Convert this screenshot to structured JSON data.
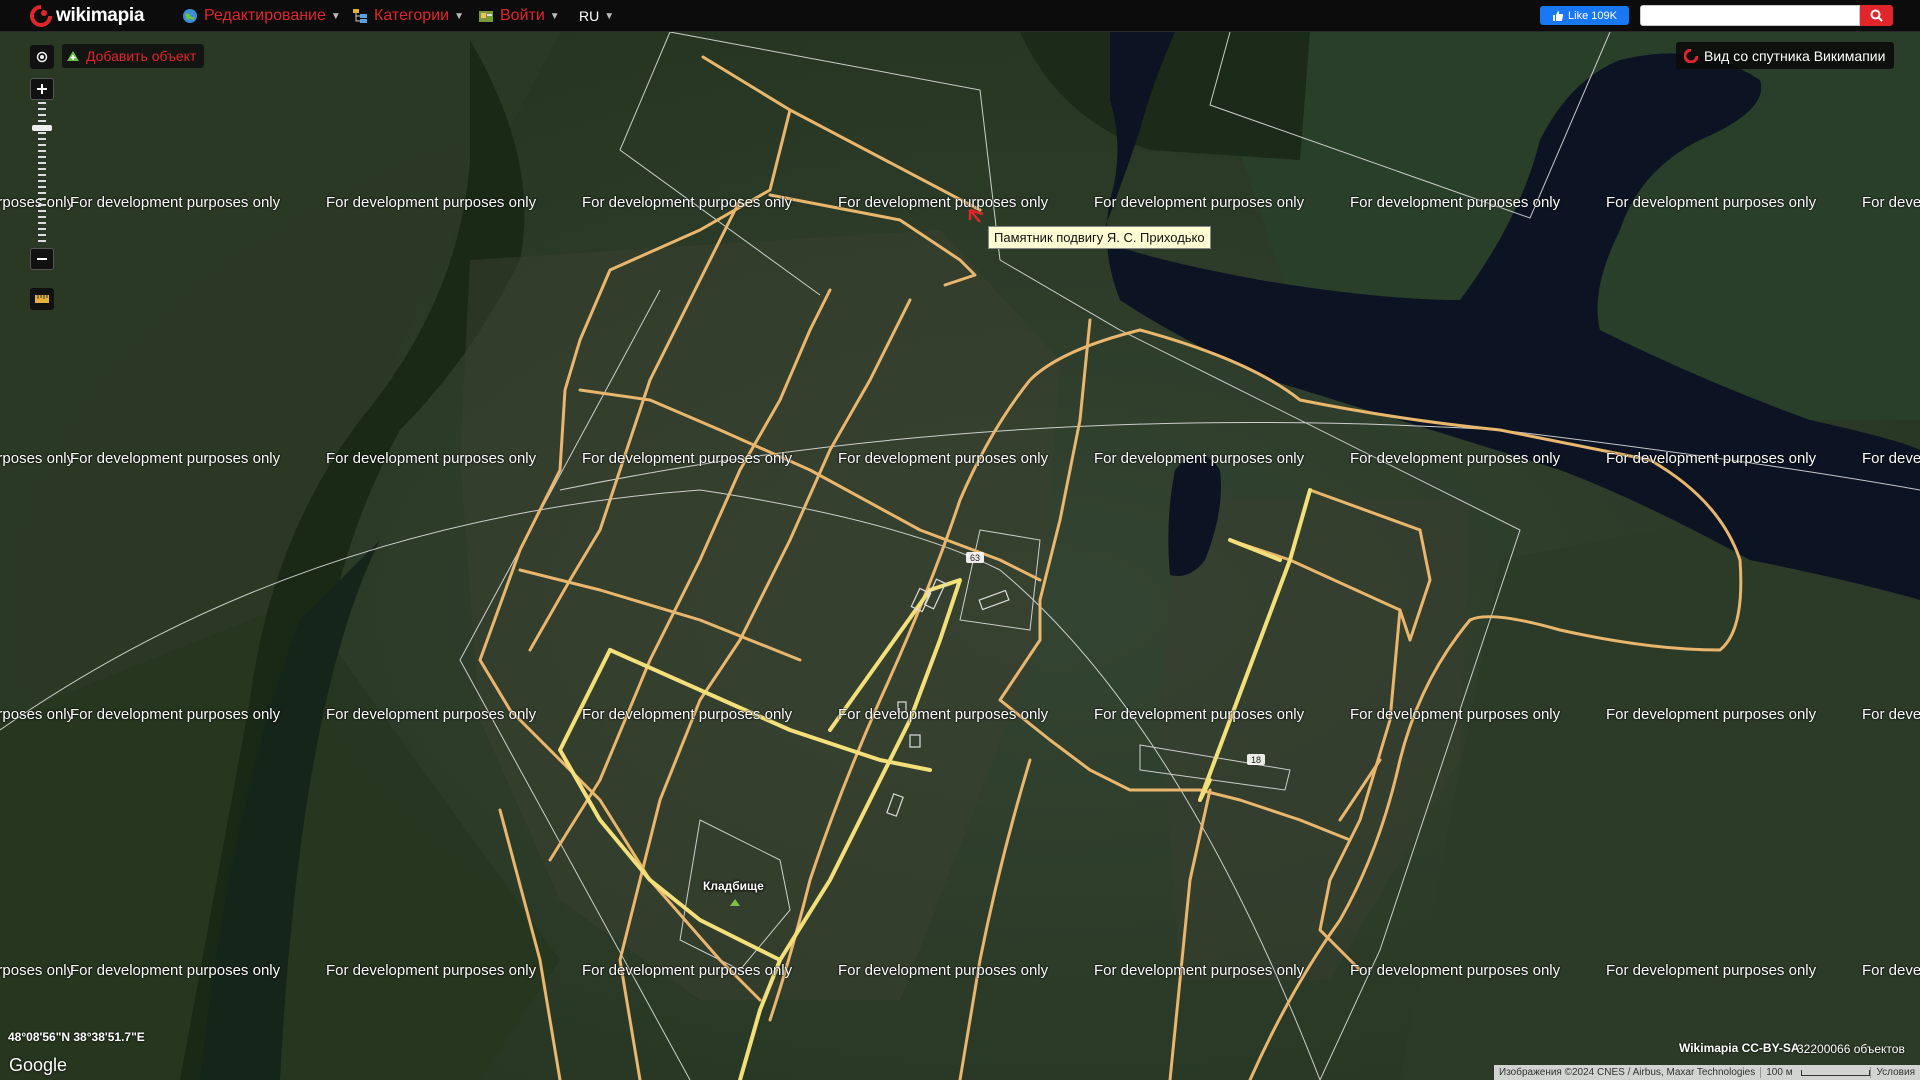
{
  "app": {
    "logo_text": "wikimapia",
    "brand_color": "#e0262a"
  },
  "menu": {
    "edit": "Редактирование",
    "categories": "Категории",
    "login": "Войти",
    "language": "RU"
  },
  "social": {
    "fb_like": "Like 109K"
  },
  "search": {
    "placeholder": "",
    "value": ""
  },
  "controls": {
    "add_object": "Добавить объект",
    "satellite_view": "Вид со спутника Викимапии"
  },
  "map": {
    "watermark_text": "For development purposes only",
    "tooltip": "Памятник подвигу Я. С. Приходько",
    "cemetery_label": "Кладбище",
    "house_numbers": [
      "63",
      "18"
    ],
    "road_color": "#e9b66d",
    "main_road_color": "#f3e07a",
    "water_color": "#0c1424"
  },
  "footer": {
    "coordinates": "48°08'56\"N 38°38'51.7\"E",
    "google": "Google",
    "license": "Wikimapia CC-BY-SA",
    "objects_count": "32200066 объектов",
    "imagery_credit": "Изображения ©2024 CNES / Airbus, Maxar Technologies",
    "scale_label": "100 м",
    "terms": "Условия"
  }
}
